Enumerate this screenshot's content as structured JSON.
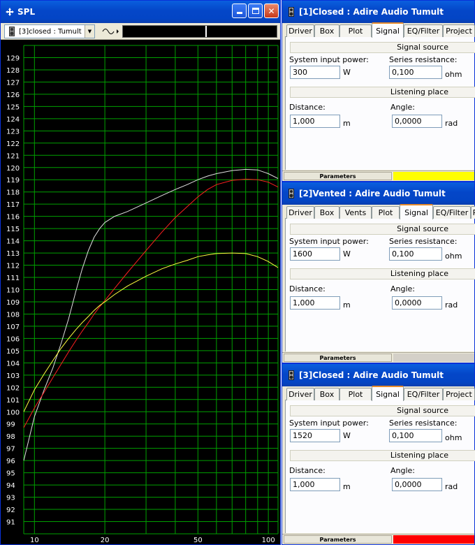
{
  "spl_window": {
    "title": "SPL",
    "combo_value": "[3]closed : Tumult",
    "x_ticks": [
      "10",
      "20",
      "50",
      "100"
    ],
    "y_ticks": [
      "129",
      "128",
      "127",
      "126",
      "125",
      "124",
      "123",
      "122",
      "121",
      "120",
      "119",
      "118",
      "117",
      "116",
      "115",
      "114",
      "113",
      "112",
      "111",
      "110",
      "109",
      "108",
      "107",
      "106",
      "105",
      "104",
      "103",
      "102",
      "101",
      "100",
      "99",
      "98",
      "97",
      "96",
      "95",
      "94",
      "93",
      "92",
      "91"
    ]
  },
  "chart_data": {
    "type": "line",
    "x_scale": "log",
    "xlim": [
      9,
      110
    ],
    "ylim": [
      90,
      130
    ],
    "grid": true,
    "series": [
      {
        "color": "#e0e0e0",
        "x": [
          9,
          10,
          11,
          12,
          13,
          14,
          15,
          16,
          17,
          18,
          19,
          20,
          22,
          25,
          30,
          35,
          40,
          45,
          50,
          55,
          60,
          70,
          80,
          90,
          100,
          110
        ],
        "values": [
          96,
          99.6,
          101.8,
          103.6,
          105.6,
          107.6,
          109.8,
          111.7,
          113.2,
          114.3,
          115.0,
          115.5,
          116.0,
          116.4,
          117.1,
          117.7,
          118.2,
          118.6,
          119.0,
          119.3,
          119.5,
          119.75,
          119.85,
          119.8,
          119.5,
          119.1
        ]
      },
      {
        "color": "#ff2020",
        "x": [
          9,
          10,
          11,
          12,
          13,
          14,
          15,
          16,
          17,
          18,
          19,
          20,
          22,
          25,
          30,
          35,
          40,
          45,
          50,
          55,
          60,
          70,
          80,
          90,
          100,
          110
        ],
        "values": [
          98.7,
          100.3,
          101.6,
          102.8,
          103.9,
          104.9,
          105.8,
          106.6,
          107.3,
          108.0,
          108.6,
          109.1,
          110.1,
          111.4,
          113.2,
          114.7,
          115.9,
          116.8,
          117.6,
          118.2,
          118.6,
          118.95,
          119.05,
          119.0,
          118.8,
          118.4
        ]
      },
      {
        "color": "#ffff40",
        "x": [
          9,
          10,
          11,
          12,
          13,
          14,
          15,
          16,
          17,
          18,
          19,
          20,
          22,
          25,
          30,
          35,
          40,
          45,
          50,
          55,
          60,
          70,
          80,
          90,
          100,
          110
        ],
        "values": [
          100,
          101.8,
          103.1,
          104.2,
          105.2,
          106.0,
          106.7,
          107.3,
          107.8,
          108.3,
          108.7,
          109.0,
          109.6,
          110.3,
          111.1,
          111.7,
          112.1,
          112.4,
          112.7,
          112.85,
          112.95,
          113.0,
          112.95,
          112.7,
          112.3,
          111.8
        ]
      }
    ]
  },
  "panels": [
    {
      "title": "[1]Closed : Adire Audio Tumult",
      "tabs": [
        "Driver",
        "Box",
        "Plot",
        "Signal",
        "EQ/Filter",
        "Project"
      ],
      "active_tab": "Signal",
      "section_signal": "Signal source",
      "power_label": "System input power:",
      "power_value": "300",
      "power_unit": "W",
      "resistance_label": "Series resistance:",
      "resistance_value": "0,100",
      "resistance_unit": "ohm",
      "section_listen": "Listening place",
      "distance_label": "Distance:",
      "distance_value": "1,000",
      "distance_unit": "m",
      "angle_label": "Angle:",
      "angle_value": "0,0000",
      "angle_unit": "rad",
      "status_label": "Parameters",
      "status_color": "#ffff00"
    },
    {
      "title": "[2]Vented : Adire Audio Tumult",
      "tabs": [
        "Driver",
        "Box",
        "Vents",
        "Plot",
        "Signal",
        "EQ/Filter",
        "P"
      ],
      "active_tab": "Signal",
      "section_signal": "Signal source",
      "power_label": "System input power:",
      "power_value": "1600",
      "power_unit": "W",
      "resistance_label": "Series resistance:",
      "resistance_value": "0,100",
      "resistance_unit": "ohm",
      "section_listen": "Listening place",
      "distance_label": "Distance:",
      "distance_value": "1,000",
      "distance_unit": "m",
      "angle_label": "Angle:",
      "angle_value": "0,0000",
      "angle_unit": "rad",
      "status_label": "Parameters",
      "status_color": "#d4d0c8"
    },
    {
      "title": "[3]Closed : Adire Audio Tumult",
      "tabs": [
        "Driver",
        "Box",
        "Plot",
        "Signal",
        "EQ/Filter",
        "Project"
      ],
      "active_tab": "Signal",
      "section_signal": "Signal source",
      "power_label": "System input power:",
      "power_value": "1520",
      "power_unit": "W",
      "resistance_label": "Series resistance:",
      "resistance_value": "0,100",
      "resistance_unit": "ohm",
      "section_listen": "Listening place",
      "distance_label": "Distance:",
      "distance_value": "1,000",
      "distance_unit": "m",
      "angle_label": "Angle:",
      "angle_value": "0,0000",
      "angle_unit": "rad",
      "status_label": "Parameters",
      "status_color": "#ff0000"
    }
  ]
}
